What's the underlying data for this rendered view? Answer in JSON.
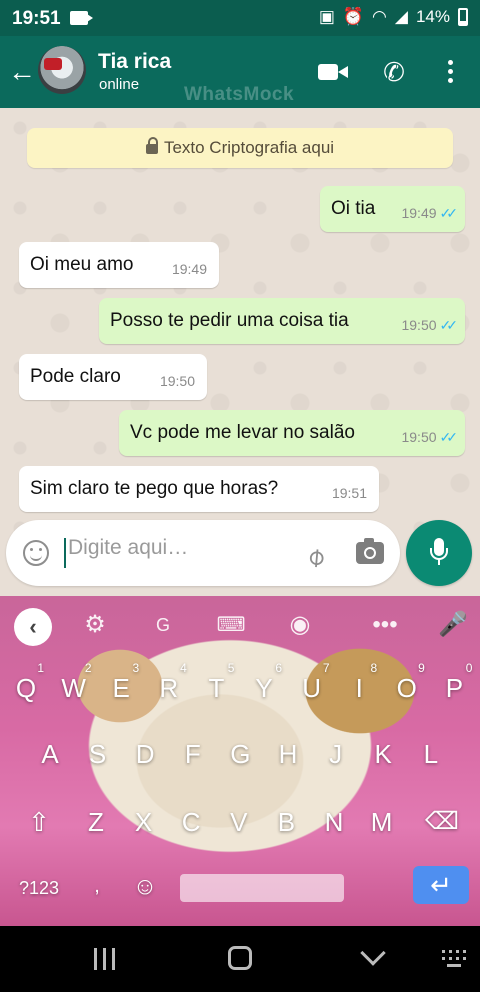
{
  "status_bar": {
    "time": "19:51",
    "battery": "14%",
    "icons": [
      "screen-record-icon",
      "cast-icon",
      "alarm-icon",
      "wifi-icon",
      "signal-icon",
      "battery-icon"
    ]
  },
  "header": {
    "contact_name": "Tia rica",
    "contact_status": "online",
    "watermark": "WhatsMock",
    "icons": [
      "back-arrow-icon",
      "video-call-icon",
      "phone-call-icon",
      "more-options-icon"
    ],
    "color": "#0b6a5c"
  },
  "chat": {
    "encryption_notice": "Texto Criptografia aqui",
    "messages": [
      {
        "direction": "out",
        "text": "Oi tia",
        "time": "19:49",
        "ticks": "✓✓"
      },
      {
        "direction": "in",
        "text": "Oi meu amo",
        "time": "19:49"
      },
      {
        "direction": "out",
        "text": "Posso te pedir uma coisa tia",
        "time": "19:50",
        "ticks": "✓✓"
      },
      {
        "direction": "in",
        "text": "Pode claro",
        "time": "19:50"
      },
      {
        "direction": "out",
        "text": "Vc pode me levar no salão",
        "time": "19:50",
        "ticks": "✓✓"
      },
      {
        "direction": "in",
        "text": "Sim claro te pego que horas?",
        "time": "19:51"
      }
    ],
    "colors": {
      "outgoing": "#dcf8c6",
      "incoming": "#ffffff",
      "read_ticks": "#34b7f1"
    }
  },
  "composer": {
    "placeholder": "Digite aqui…",
    "value": ""
  },
  "keyboard": {
    "row1": [
      {
        "k": "Q",
        "n": "1"
      },
      {
        "k": "W",
        "n": "2"
      },
      {
        "k": "E",
        "n": "3"
      },
      {
        "k": "R",
        "n": "4"
      },
      {
        "k": "T",
        "n": "5"
      },
      {
        "k": "Y",
        "n": "6"
      },
      {
        "k": "U",
        "n": "7"
      },
      {
        "k": "I",
        "n": "8"
      },
      {
        "k": "O",
        "n": "9"
      },
      {
        "k": "P",
        "n": "0"
      }
    ],
    "row2": [
      "A",
      "S",
      "D",
      "F",
      "G",
      "H",
      "J",
      "K",
      "L"
    ],
    "row3": [
      "Z",
      "X",
      "C",
      "V",
      "B",
      "N",
      "M"
    ],
    "symbols_key": "?123",
    "comma_key": ",",
    "toolbar_icons": [
      "back-chevron-icon",
      "settings-icon",
      "translate-icon",
      "keyboard-icon",
      "palette-icon",
      "more-icon",
      "microphone-icon"
    ]
  },
  "nav_bar": {
    "icons": [
      "recents-icon",
      "home-icon",
      "back-icon",
      "keyboard-switch-icon"
    ]
  }
}
